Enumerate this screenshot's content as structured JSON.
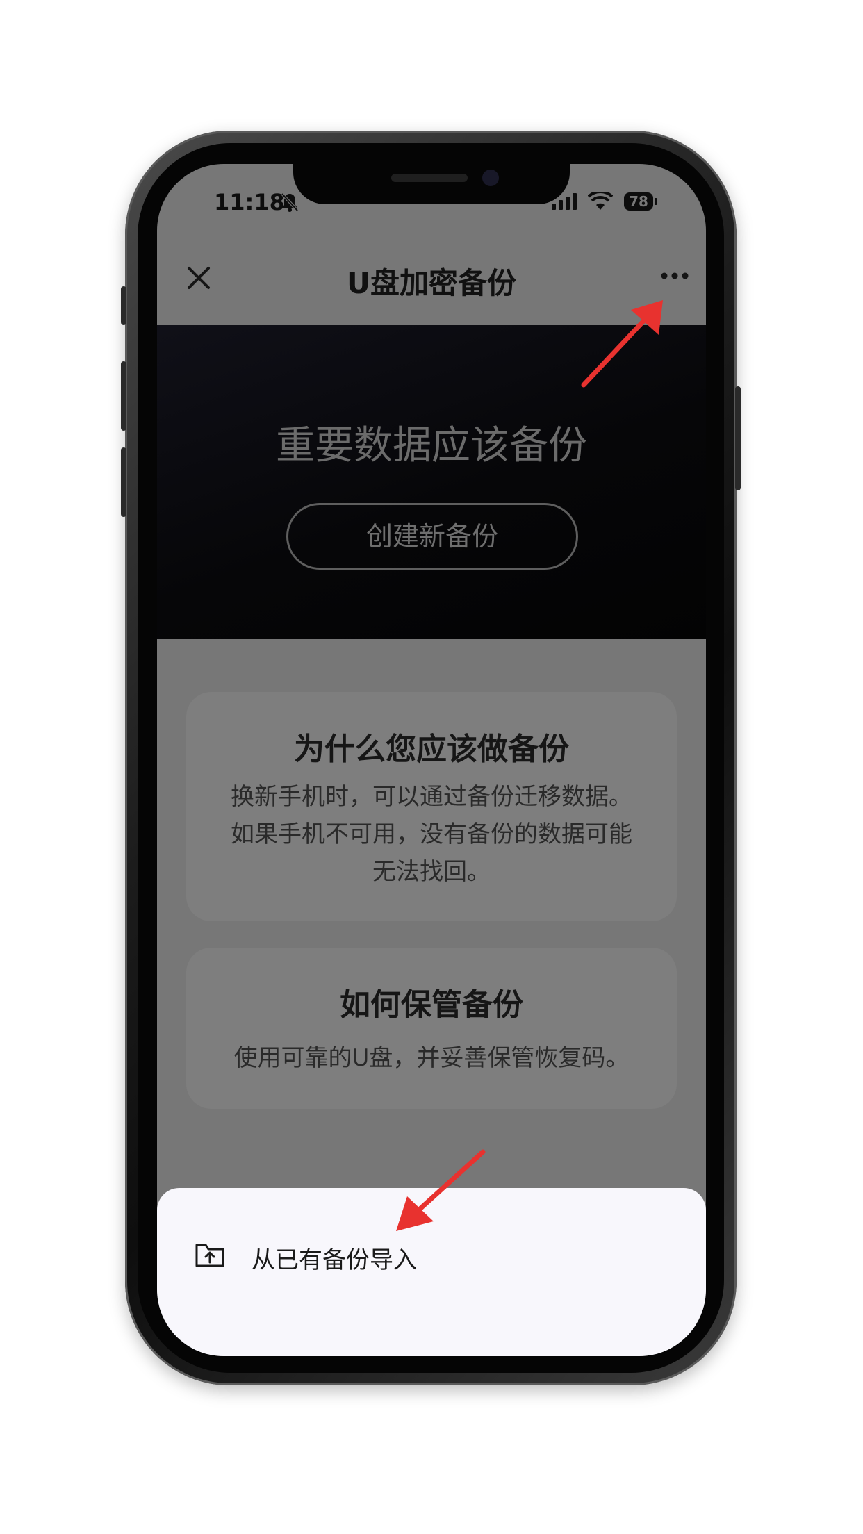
{
  "status_bar": {
    "time": "11:18",
    "battery": "78",
    "icons": [
      "bell-slash-icon",
      "signal-icon",
      "wifi-icon",
      "battery-icon"
    ]
  },
  "nav": {
    "title": "U盘加密备份",
    "close_icon": "close-icon",
    "more_icon": "more-icon"
  },
  "hero": {
    "title": "重要数据应该备份",
    "button": "创建新备份"
  },
  "cards": [
    {
      "title": "为什么您应该做备份",
      "lines": [
        "换新手机时，可以通过备份迁移数据。",
        "如果手机不可用，没有备份的数据可能",
        "无法找回。"
      ]
    },
    {
      "title": "如何保管备份",
      "lines": [
        "使用可靠的U盘，并妥善保管恢复码。"
      ]
    }
  ],
  "sheet": {
    "items": [
      {
        "label": "从已有备份导入",
        "icon": "folder-upload-icon"
      }
    ]
  },
  "colors": {
    "annotation_arrow": "#e8322f",
    "overlay_dim": "#777777",
    "sheet_bg": "#f8f7fc"
  }
}
